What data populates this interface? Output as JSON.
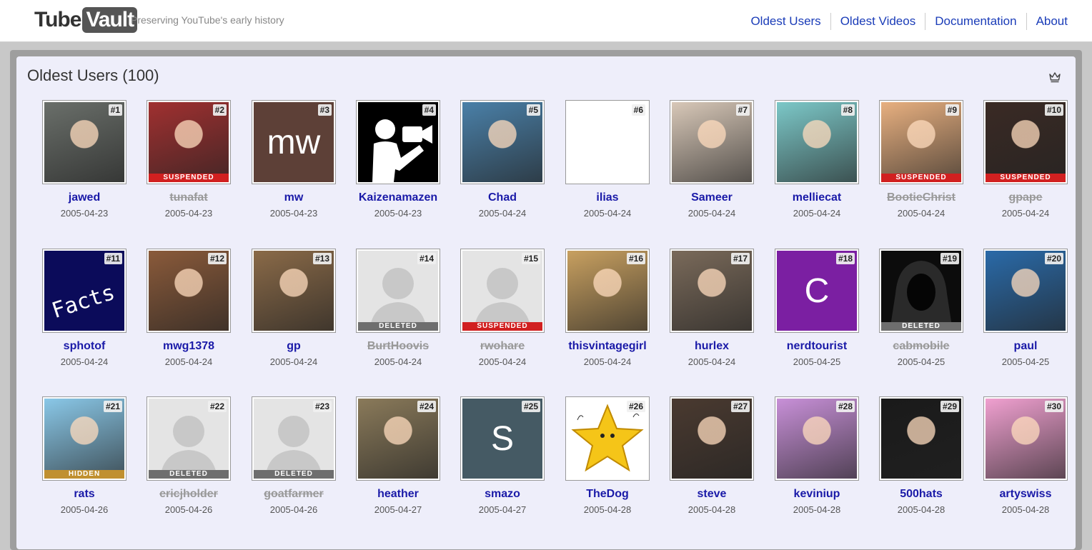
{
  "header": {
    "logo_part1": "Tube",
    "logo_part2": "Vault",
    "tagline": "Preserving YouTube's early history",
    "nav": [
      "Oldest Users",
      "Oldest Videos",
      "Documentation",
      "About"
    ]
  },
  "panel": {
    "title": "Oldest Users (100)",
    "crown_icon": "crown-icon"
  },
  "colors": {
    "link": "#1a1aa8",
    "suspended": "#d12020",
    "deleted": "#6e6e6e",
    "hidden": "#c09030",
    "panel_bg": "#eeeefa"
  },
  "users": [
    {
      "rank": "#1",
      "name": "jawed",
      "date": "2005-04-23",
      "status": "",
      "avatar": "photo",
      "bg": "#6a6f6a"
    },
    {
      "rank": "#2",
      "name": "tunafat",
      "date": "2005-04-23",
      "status": "SUSPENDED",
      "avatar": "photo",
      "bg": "#a03030"
    },
    {
      "rank": "#3",
      "name": "mw",
      "date": "2005-04-23",
      "status": "",
      "avatar": "letter",
      "letter": "mw",
      "bg": "#5d4037"
    },
    {
      "rank": "#4",
      "name": "Kaizenamazen",
      "date": "2005-04-23",
      "status": "",
      "avatar": "camera",
      "bg": "#000000"
    },
    {
      "rank": "#5",
      "name": "Chad",
      "date": "2005-04-24",
      "status": "",
      "avatar": "photo",
      "bg": "#4a80a8"
    },
    {
      "rank": "#6",
      "name": "ilias",
      "date": "2005-04-24",
      "status": "",
      "avatar": "blank",
      "bg": "#ffffff"
    },
    {
      "rank": "#7",
      "name": "Sameer",
      "date": "2005-04-24",
      "status": "",
      "avatar": "photo",
      "bg": "#d8c8b8"
    },
    {
      "rank": "#8",
      "name": "melliecat",
      "date": "2005-04-24",
      "status": "",
      "avatar": "photo",
      "bg": "#7cc8c8"
    },
    {
      "rank": "#9",
      "name": "BootieChrist",
      "date": "2005-04-24",
      "status": "SUSPENDED",
      "avatar": "photo",
      "bg": "#e8b080"
    },
    {
      "rank": "#10",
      "name": "gpape",
      "date": "2005-04-24",
      "status": "SUSPENDED",
      "avatar": "photo",
      "bg": "#3a2a24"
    },
    {
      "rank": "#11",
      "name": "sphotof",
      "date": "2005-04-24",
      "status": "",
      "avatar": "facts",
      "bg": "#0b0b5a"
    },
    {
      "rank": "#12",
      "name": "mwg1378",
      "date": "2005-04-24",
      "status": "",
      "avatar": "photo",
      "bg": "#8a5a3a"
    },
    {
      "rank": "#13",
      "name": "gp",
      "date": "2005-04-24",
      "status": "",
      "avatar": "photo",
      "bg": "#8a6a48"
    },
    {
      "rank": "#14",
      "name": "BurtHoovis",
      "date": "2005-04-24",
      "status": "DELETED",
      "avatar": "silhouette",
      "bg": "#e6e6e6"
    },
    {
      "rank": "#15",
      "name": "rwohare",
      "date": "2005-04-24",
      "status": "SUSPENDED",
      "avatar": "silhouette",
      "bg": "#e6e6e6"
    },
    {
      "rank": "#16",
      "name": "thisvintagegirl",
      "date": "2005-04-24",
      "status": "",
      "avatar": "photo",
      "bg": "#c8a060"
    },
    {
      "rank": "#17",
      "name": "hurlex",
      "date": "2005-04-24",
      "status": "",
      "avatar": "photo",
      "bg": "#7a6a5a"
    },
    {
      "rank": "#18",
      "name": "nerdtourist",
      "date": "2005-04-25",
      "status": "",
      "avatar": "letter",
      "letter": "C",
      "bg": "#7b1fa2"
    },
    {
      "rank": "#19",
      "name": "cabmobile",
      "date": "2005-04-25",
      "status": "DELETED",
      "avatar": "hood",
      "bg": "#111111"
    },
    {
      "rank": "#20",
      "name": "paul",
      "date": "2005-04-25",
      "status": "",
      "avatar": "photo",
      "bg": "#2a6aa8"
    },
    {
      "rank": "#21",
      "name": "rats",
      "date": "2005-04-26",
      "status": "HIDDEN",
      "avatar": "photo",
      "bg": "#8ac8e8"
    },
    {
      "rank": "#22",
      "name": "ericjholder",
      "date": "2005-04-26",
      "status": "DELETED",
      "avatar": "silhouette",
      "bg": "#e6e6e6"
    },
    {
      "rank": "#23",
      "name": "goatfarmer",
      "date": "2005-04-26",
      "status": "DELETED",
      "avatar": "silhouette",
      "bg": "#e6e6e6"
    },
    {
      "rank": "#24",
      "name": "heather",
      "date": "2005-04-27",
      "status": "",
      "avatar": "photo",
      "bg": "#8a7a5a"
    },
    {
      "rank": "#25",
      "name": "smazo",
      "date": "2005-04-27",
      "status": "",
      "avatar": "letter",
      "letter": "S",
      "bg": "#455a64"
    },
    {
      "rank": "#26",
      "name": "TheDog",
      "date": "2005-04-28",
      "status": "",
      "avatar": "star",
      "bg": "#ffffff"
    },
    {
      "rank": "#27",
      "name": "steve",
      "date": "2005-04-28",
      "status": "",
      "avatar": "photo",
      "bg": "#4a3a30"
    },
    {
      "rank": "#28",
      "name": "keviniup",
      "date": "2005-04-28",
      "status": "",
      "avatar": "photo",
      "bg": "#c890d8"
    },
    {
      "rank": "#29",
      "name": "500hats",
      "date": "2005-04-28",
      "status": "",
      "avatar": "photo",
      "bg": "#1a1a1a"
    },
    {
      "rank": "#30",
      "name": "artyswiss",
      "date": "2005-04-28",
      "status": "",
      "avatar": "photo",
      "bg": "#f0a0d0"
    }
  ]
}
